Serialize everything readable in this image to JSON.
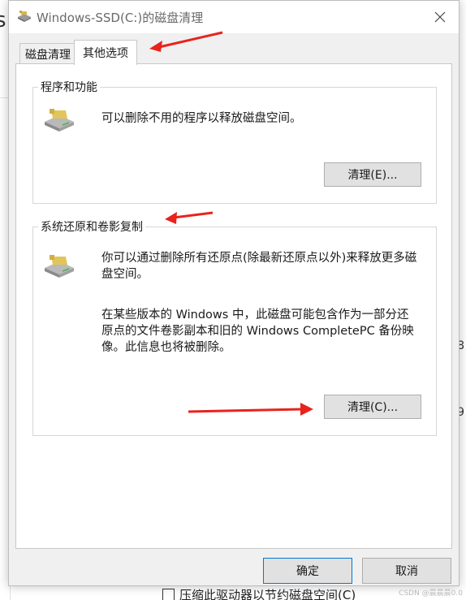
{
  "window": {
    "title": "Windows-SSD(C:)的磁盘清理",
    "title_icon": "disk-cleanup-icon",
    "close_icon": "close-icon"
  },
  "tabs": [
    {
      "label": "磁盘清理",
      "active": false
    },
    {
      "label": "其他选项",
      "active": true
    }
  ],
  "groups": {
    "programs": {
      "title": "程序和功能",
      "icon": "drive-icon",
      "description": "可以删除不用的程序以释放磁盘空间。",
      "button_label": "清理(E)..."
    },
    "restore": {
      "title": "系统还原和卷影复制",
      "icon": "drive-icon",
      "description_line1": "你可以通过删除所有还原点(除最新还原点以外)来释放更多磁",
      "description_line2": "盘空间。",
      "note_line1": "在某些版本的 Windows 中，此磁盘可能包含作为一部分还",
      "note_line2": "原点的文件卷影副本和旧的 Windows CompletePC 备份映",
      "note_line3": "像。此信息也将被删除。",
      "button_label": "清理(C)..."
    }
  },
  "footer": {
    "ok_label": "确定",
    "cancel_label": "取消"
  },
  "background": {
    "left_glyph": "s",
    "right_chars": [
      "8",
      "9"
    ],
    "bottom_checkbox_label": "压缩此驱动器以节约磁盘空间(C)"
  },
  "watermark": "CSDN @晨晨晨0.0",
  "colors": {
    "annotation_arrow": "#e8231c",
    "dialog_bg": "#f0f0f0",
    "panel_bg": "#ffffff",
    "accent": "#0078d4"
  }
}
